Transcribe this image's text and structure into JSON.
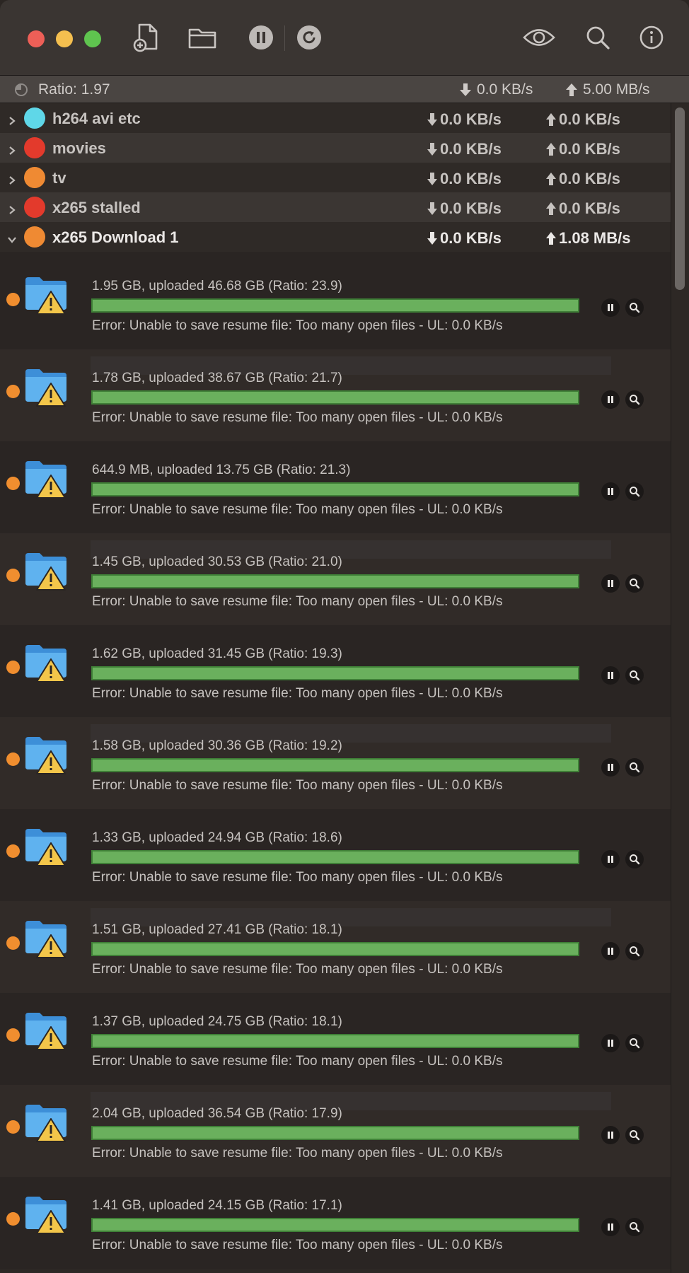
{
  "toolbar": {
    "buttons": [
      "traffic-close",
      "traffic-minimize",
      "traffic-zoom",
      "add-torrent",
      "open-folder",
      "pause-all",
      "resume-all",
      "quicklook",
      "search",
      "info"
    ]
  },
  "status": {
    "ratio": "Ratio: 1.97",
    "download": "0.0 KB/s",
    "upload": "5.00 MB/s"
  },
  "groups": [
    {
      "name": "h264 avi etc",
      "color": "#5fd7e8",
      "dl": "0.0 KB/s",
      "ul": "0.0 KB/s",
      "expanded": false
    },
    {
      "name": "movies",
      "color": "#e33a2c",
      "dl": "0.0 KB/s",
      "ul": "0.0 KB/s",
      "expanded": false
    },
    {
      "name": "tv",
      "color": "#ef8a33",
      "dl": "0.0 KB/s",
      "ul": "0.0 KB/s",
      "expanded": false
    },
    {
      "name": "x265 stalled",
      "color": "#e33a2c",
      "dl": "0.0 KB/s",
      "ul": "0.0 KB/s",
      "expanded": false
    },
    {
      "name": "x265 Download 1",
      "color": "#ef8a33",
      "dl": "0.0 KB/s",
      "ul": "1.08 MB/s",
      "expanded": true
    }
  ],
  "torrents": [
    {
      "size": "1.95 GB, uploaded 46.68 GB (Ratio: 23.9)",
      "status": "Error: Unable to save resume file: Too many open files - UL: 0.0 KB/s",
      "progress": 1.0
    },
    {
      "size": "1.78 GB, uploaded 38.67 GB (Ratio: 21.7)",
      "status": "Error: Unable to save resume file: Too many open files - UL: 0.0 KB/s",
      "progress": 1.0
    },
    {
      "size": "644.9 MB, uploaded 13.75 GB (Ratio: 21.3)",
      "status": "Error: Unable to save resume file: Too many open files - UL: 0.0 KB/s",
      "progress": 1.0
    },
    {
      "size": "1.45 GB, uploaded 30.53 GB (Ratio: 21.0)",
      "status": "Error: Unable to save resume file: Too many open files - UL: 0.0 KB/s",
      "progress": 1.0
    },
    {
      "size": "1.62 GB, uploaded 31.45 GB (Ratio: 19.3)",
      "status": "Error: Unable to save resume file: Too many open files - UL: 0.0 KB/s",
      "progress": 1.0
    },
    {
      "size": "1.58 GB, uploaded 30.36 GB (Ratio: 19.2)",
      "status": "Error: Unable to save resume file: Too many open files - UL: 0.0 KB/s",
      "progress": 1.0
    },
    {
      "size": "1.33 GB, uploaded 24.94 GB (Ratio: 18.6)",
      "status": "Error: Unable to save resume file: Too many open files - UL: 0.0 KB/s",
      "progress": 1.0
    },
    {
      "size": "1.51 GB, uploaded 27.41 GB (Ratio: 18.1)",
      "status": "Error: Unable to save resume file: Too many open files - UL: 0.0 KB/s",
      "progress": 1.0
    },
    {
      "size": "1.37 GB, uploaded 24.75 GB (Ratio: 18.1)",
      "status": "Error: Unable to save resume file: Too many open files - UL: 0.0 KB/s",
      "progress": 1.0
    },
    {
      "size": "2.04 GB, uploaded 36.54 GB (Ratio: 17.9)",
      "status": "Error: Unable to save resume file: Too many open files - UL: 0.0 KB/s",
      "progress": 1.0
    },
    {
      "size": "1.41 GB, uploaded 24.15 GB (Ratio: 17.1)",
      "status": "Error: Unable to save resume file: Too many open files - UL: 0.0 KB/s",
      "progress": 1.0
    }
  ],
  "colors": {
    "progress": "#6ab05d",
    "status_dot": "#f08e2f",
    "folder": "#4aa3e4",
    "warning": "#f3c64a"
  }
}
